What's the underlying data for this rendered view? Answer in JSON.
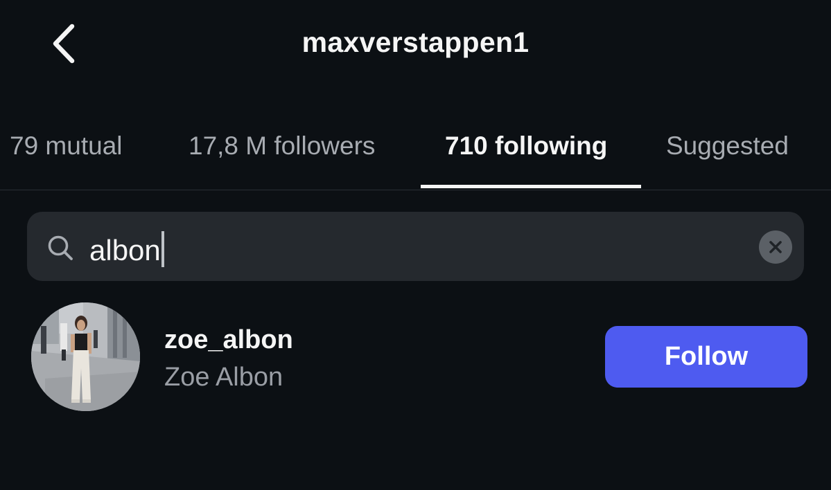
{
  "header": {
    "title": "maxverstappen1",
    "back_icon": "chevron-left-icon"
  },
  "tabs": [
    {
      "label": "79 mutual",
      "active": false
    },
    {
      "label": "17,8 M followers",
      "active": false
    },
    {
      "label": "710 following",
      "active": true
    },
    {
      "label": "Suggested",
      "active": false
    }
  ],
  "search": {
    "value": "albon",
    "icon": "search-icon",
    "clear_icon": "close-icon"
  },
  "results": [
    {
      "username": "zoe_albon",
      "full_name": "Zoe Albon",
      "button_label": "Follow"
    }
  ],
  "colors": {
    "background": "#0c1014",
    "search_bg": "#25292e",
    "accent": "#4e5bf0",
    "secondary_text": "#a8acb2"
  }
}
